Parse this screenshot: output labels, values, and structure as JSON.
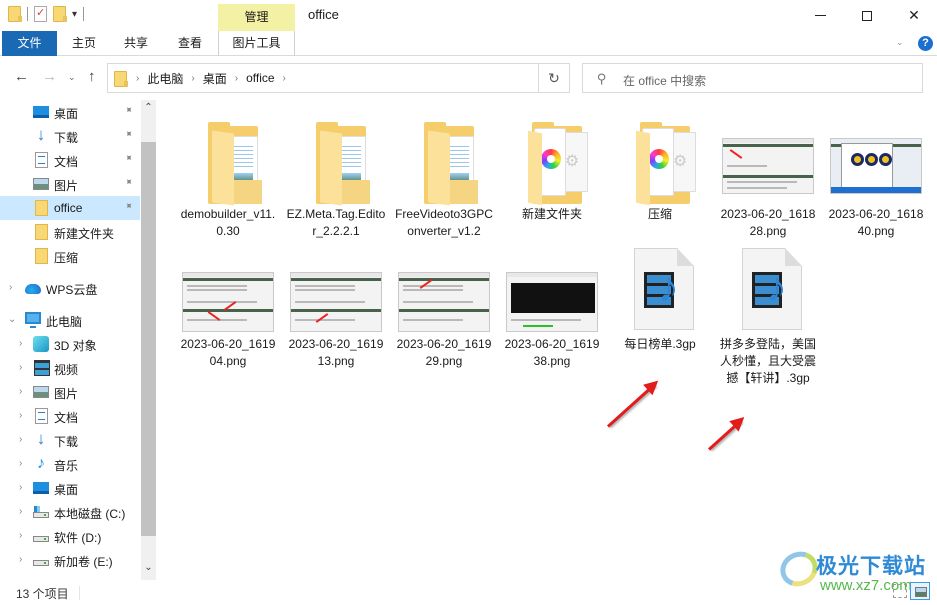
{
  "window": {
    "title": "office",
    "contextual_tab_group": "管理",
    "controls": {
      "minimize": "minimize",
      "maximize": "maximize",
      "close": "✕"
    }
  },
  "ribbon": {
    "tabs": [
      {
        "label": "文件",
        "active": true
      },
      {
        "label": "主页"
      },
      {
        "label": "共享"
      },
      {
        "label": "查看"
      },
      {
        "label": "图片工具"
      }
    ],
    "expand_glyph": "⌄",
    "help_glyph": "?"
  },
  "navigation": {
    "back": "←",
    "forward": "→",
    "recent": "⌄",
    "up": "↑",
    "breadcrumb": [
      "此电脑",
      "桌面",
      "office"
    ],
    "crumb_separator": "›",
    "dropdown": "⌄",
    "refresh": "↻",
    "search_placeholder": "在 office 中搜索",
    "search_glyph": "⚲"
  },
  "sidebar": {
    "quick_access": [
      {
        "label": "桌面",
        "icon": "desktop-icon",
        "pinned": true
      },
      {
        "label": "下载",
        "icon": "download-icon",
        "pinned": true
      },
      {
        "label": "文档",
        "icon": "document-icon",
        "pinned": true
      },
      {
        "label": "图片",
        "icon": "picture-icon",
        "pinned": true
      },
      {
        "label": "office",
        "icon": "folder-icon",
        "pinned": true,
        "selected": true
      },
      {
        "label": "新建文件夹",
        "icon": "folder-icon"
      },
      {
        "label": "压缩",
        "icon": "folder-icon"
      }
    ],
    "wps_cloud": {
      "label": "WPS云盘",
      "chevron": "›"
    },
    "this_pc": {
      "label": "此电脑",
      "chevron": "⌄",
      "children": [
        {
          "label": "3D 对象",
          "icon": "3d-objects-icon"
        },
        {
          "label": "视频",
          "icon": "video-icon"
        },
        {
          "label": "图片",
          "icon": "picture-icon"
        },
        {
          "label": "文档",
          "icon": "document-icon"
        },
        {
          "label": "下载",
          "icon": "download-icon"
        },
        {
          "label": "音乐",
          "icon": "music-icon"
        },
        {
          "label": "桌面",
          "icon": "desktop-icon"
        },
        {
          "label": "本地磁盘 (C:)",
          "icon": "system-drive-icon"
        },
        {
          "label": "软件 (D:)",
          "icon": "drive-icon"
        },
        {
          "label": "新加卷 (E:)",
          "icon": "drive-icon"
        }
      ]
    },
    "child_chevron": "›",
    "pin_glyph": "📌",
    "scroll_up": "⌃",
    "scroll_down": "⌄"
  },
  "files": [
    {
      "name": "demobuilder_v11.0.30",
      "type": "folder"
    },
    {
      "name": "EZ.Meta.Tag.Editor_2.2.2.1",
      "type": "folder"
    },
    {
      "name": "FreeVideoto3GPConverter_v1.2",
      "type": "folder"
    },
    {
      "name": "新建文件夹",
      "type": "folder-media"
    },
    {
      "name": "压缩",
      "type": "folder-media"
    },
    {
      "name": "2023-06-20_161828.png",
      "type": "image"
    },
    {
      "name": "2023-06-20_161840.png",
      "type": "image"
    },
    {
      "name": "2023-06-20_161904.png",
      "type": "image"
    },
    {
      "name": "2023-06-20_161913.png",
      "type": "image"
    },
    {
      "name": "2023-06-20_161929.png",
      "type": "image"
    },
    {
      "name": "2023-06-20_161938.png",
      "type": "image"
    },
    {
      "name": "每日榜单.3gp",
      "type": "3gp"
    },
    {
      "name": "拼多多登陆，美国人秒懂，且大受震撼【轩讲】.3gp",
      "type": "3gp"
    }
  ],
  "status": {
    "item_count": "13 个项目"
  },
  "watermark": {
    "title": "极光下载站",
    "url": "www.xz7.com"
  },
  "colors": {
    "accent": "#1a69b5",
    "selection": "#cce8ff",
    "manage_tab": "#f3f1a3",
    "arrow": "#e21b1b"
  }
}
